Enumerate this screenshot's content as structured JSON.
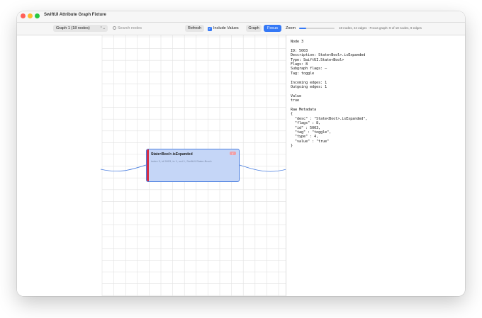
{
  "window": {
    "title": "SwiftUI Attribute Graph Fixture"
  },
  "toolbar": {
    "graph_select": "Graph 1 (18 nodes)",
    "search_placeholder": "Search nodes",
    "refresh_label": "Refresh",
    "include_values_label": "Include Values",
    "include_values_checked": true,
    "graph_label": "Graph",
    "focus_label": "Focus",
    "zoom_label": "Zoom",
    "zoom_level": 0.2,
    "stats": "18 nodes, 24 edges · Focus graph: 9 of 18 nodes, 9 edges"
  },
  "node": {
    "title": "State<Bool>.isExpanded",
    "subtitle": "index 3, id 5003, in 1, out 1, SwiftUI.State<Bool>",
    "badge": "ƒ"
  },
  "inspector": {
    "heading": "Node 3",
    "id_line": "ID: 5003",
    "description_line": "Description: State<Bool>.isExpanded",
    "type_line": "Type: SwiftUI.State<Bool>",
    "flags_line": "Flags: 8",
    "subgraph_line": "Subgraph flags: –",
    "tag_line": "Tag: toggle",
    "incoming_line": "Incoming edges: 1",
    "outgoing_line": "Outgoing edges: 1",
    "value_heading": "Value",
    "value": "true",
    "raw_heading": "Raw Metadata",
    "raw_lines": [
      "{",
      "  \"desc\" : \"State<Bool>.isExpanded\",",
      "  \"flags\" : 8,",
      "  \"id\" : 5003,",
      "  \"tag\" : \"toggle\",",
      "  \"type\" : 4,",
      "  \"value\" : \"true\"",
      "}"
    ]
  },
  "colors": {
    "accent": "#3478f6",
    "node_fill": "#c5d6f7",
    "node_border": "#4b7fe0",
    "node_marker": "#d62e45"
  }
}
